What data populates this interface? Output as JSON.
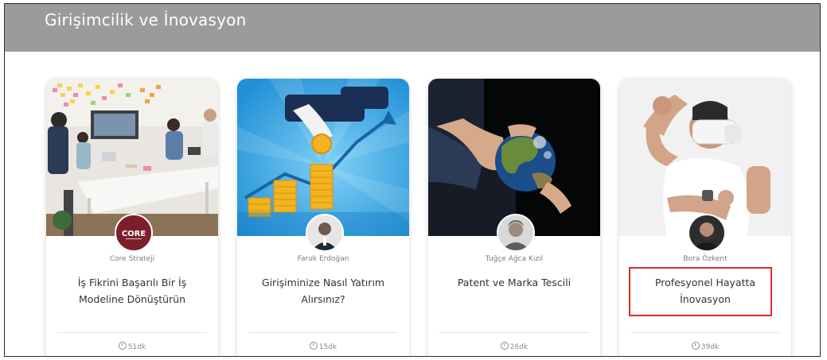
{
  "section": {
    "title": "Girişimcilik ve İnovasyon"
  },
  "courses": [
    {
      "author": "Core Strateji",
      "title_line1": "İş Fikrini Başarılı Bir İş",
      "title_line2": "Modeline Dönüştürün",
      "duration": "51dk",
      "avatar_text": "CORE"
    },
    {
      "author": "Faruk Erdoğan",
      "title_line1": "Girişiminize Nasıl Yatırım",
      "title_line2": "Alırsınız?",
      "duration": "15dk"
    },
    {
      "author": "Tuğçe Ağca Kızıl",
      "title_line1": "Patent ve Marka Tescili",
      "title_line2": "",
      "duration": "26dk"
    },
    {
      "author": "Bora Özkent",
      "title_line1": "Profesyonel Hayatta",
      "title_line2": "İnovasyon",
      "duration": "39dk",
      "highlighted": true
    }
  ],
  "colors": {
    "banner": "#9b9b9b",
    "highlight": "#d92b2b"
  }
}
